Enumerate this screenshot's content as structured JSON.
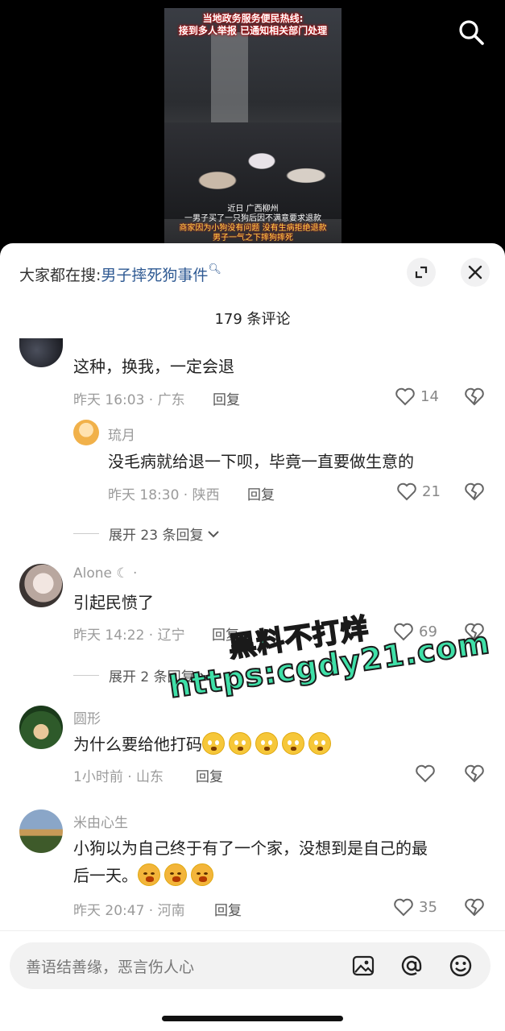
{
  "video": {
    "caption_top_1": "当地政务服务便民热线:",
    "caption_top_2": "接到多人举报 已通知相关部门处理",
    "caption_bottom_1": "近日 广西柳州",
    "caption_bottom_2": "一男子买了一只狗后因不满意要求退款",
    "caption_bottom_3": "商家因为小狗没有问题 没有生病拒绝退款",
    "caption_bottom_4": "男子一气之下摔狗摔死"
  },
  "header": {
    "hot_search_label": "大家都在搜:",
    "hot_search_query": "男子摔死狗事件",
    "comment_count": "179 条评论"
  },
  "comments": [
    {
      "username": "",
      "text": "这种，换我，一定会退",
      "time_location": "昨天 16:03 · 广东",
      "reply_label": "回复",
      "likes": "14"
    },
    {
      "username": "琉月",
      "text": "没毛病就给退一下呗，毕竟一直要做生意的",
      "time_location": "昨天 18:30 · 陕西",
      "reply_label": "回复",
      "likes": "21"
    },
    {
      "username": "Alone ☾ ·",
      "text": "引起民愤了",
      "time_location": "昨天 14:22 · 辽宁",
      "reply_label": "回复",
      "likes": "69"
    },
    {
      "username": "圆形",
      "text": "为什么要给他打码",
      "time_location": "1小时前 · 山东",
      "reply_label": "回复",
      "likes": ""
    },
    {
      "username": "米由心生",
      "text_line1": "小狗以为自己终于有了一个家，没想到是自己的最",
      "text_line2": "后一天。",
      "time_location": "昨天 20:47 · 河南",
      "reply_label": "回复",
      "likes": "35"
    }
  ],
  "expand_replies": [
    "展开 23 条回复",
    "展开 2 条回复"
  ],
  "watermark": {
    "line1": "黑料不打烊",
    "line2": "https:cgdy21.com"
  },
  "input": {
    "placeholder": "善语结善缘，恶言伤人心"
  },
  "colors": {
    "link_blue": "#2f5a93",
    "watermark_green": "#3fe0a8"
  }
}
